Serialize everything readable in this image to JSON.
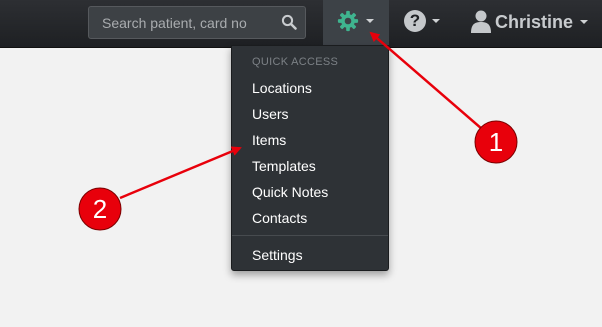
{
  "search": {
    "placeholder": "Search patient, card no",
    "icon": "search-icon"
  },
  "settings_menu": {
    "icon": "gear-icon",
    "icon_color": "#3fb48f"
  },
  "help": {
    "icon": "question-icon"
  },
  "user": {
    "name": "Christine",
    "icon": "user-icon"
  },
  "dropdown": {
    "header": "QUICK ACCESS",
    "items": [
      {
        "label": "Locations"
      },
      {
        "label": "Users"
      },
      {
        "label": "Items"
      },
      {
        "label": "Templates"
      },
      {
        "label": "Quick Notes"
      },
      {
        "label": "Contacts"
      }
    ],
    "footer_item": {
      "label": "Settings"
    }
  },
  "annotations": [
    {
      "number": "1",
      "color": "#e8000b"
    },
    {
      "number": "2",
      "color": "#e8000b"
    }
  ]
}
